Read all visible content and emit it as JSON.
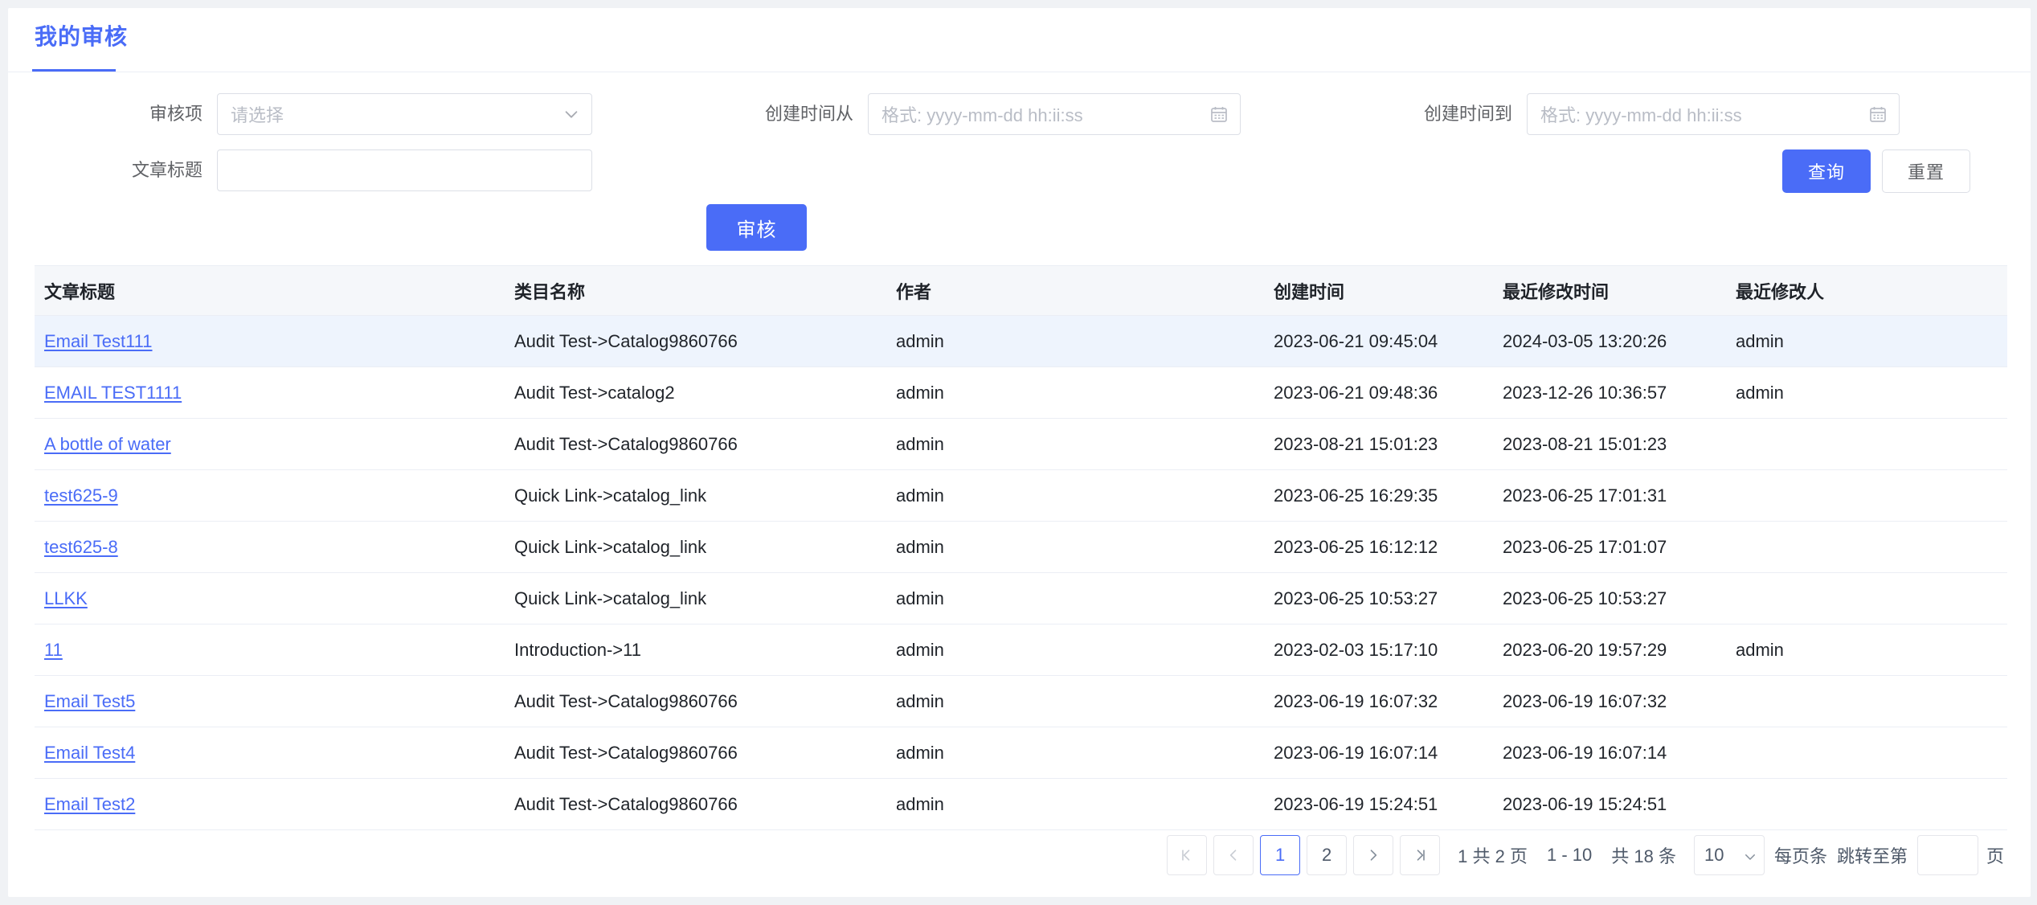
{
  "header": {
    "tab_label": "我的审核"
  },
  "filters": {
    "audit_item": {
      "label": "审核项",
      "value": "请选择",
      "is_placeholder": true,
      "icon": "chevron-down-icon"
    },
    "article_title": {
      "label": "文章标题",
      "value": "",
      "placeholder": ""
    },
    "created_from": {
      "label": "创建时间从",
      "value": "",
      "placeholder": "格式: yyyy-mm-dd hh:ii:ss",
      "icon": "calendar-icon"
    },
    "created_to": {
      "label": "创建时间到",
      "value": "",
      "placeholder": "格式: yyyy-mm-dd hh:ii:ss",
      "icon": "calendar-icon"
    },
    "query_button": "查询",
    "reset_button": "重置"
  },
  "actions": {
    "audit_button": "审核"
  },
  "table": {
    "columns": [
      "文章标题",
      "类目名称",
      "作者",
      "创建时间",
      "最近修改时间",
      "最近修改人"
    ],
    "rows": [
      {
        "title": "Email Test111",
        "catalog": "Audit Test->Catalog9860766",
        "author": "admin",
        "created": "2023-06-21 09:45:04",
        "modified": "2024-03-05 13:20:26",
        "modifier": "admin",
        "highlighted": true
      },
      {
        "title": "EMAIL TEST1111",
        "catalog": "Audit Test->catalog2",
        "author": "admin",
        "created": "2023-06-21 09:48:36",
        "modified": "2023-12-26 10:36:57",
        "modifier": "admin",
        "highlighted": false
      },
      {
        "title": "A bottle of water",
        "catalog": "Audit Test->Catalog9860766",
        "author": "admin",
        "created": "2023-08-21 15:01:23",
        "modified": "2023-08-21 15:01:23",
        "modifier": "",
        "highlighted": false
      },
      {
        "title": "test625-9",
        "catalog": "Quick Link->catalog_link",
        "author": "admin",
        "created": "2023-06-25 16:29:35",
        "modified": "2023-06-25 17:01:31",
        "modifier": "",
        "highlighted": false
      },
      {
        "title": "test625-8",
        "catalog": "Quick Link->catalog_link",
        "author": "admin",
        "created": "2023-06-25 16:12:12",
        "modified": "2023-06-25 17:01:07",
        "modifier": "",
        "highlighted": false
      },
      {
        "title": "LLKK",
        "catalog": "Quick Link->catalog_link",
        "author": "admin",
        "created": "2023-06-25 10:53:27",
        "modified": "2023-06-25 10:53:27",
        "modifier": "",
        "highlighted": false
      },
      {
        "title": "11",
        "catalog": "Introduction->11",
        "author": "admin",
        "created": "2023-02-03 15:17:10",
        "modified": "2023-06-20 19:57:29",
        "modifier": "admin",
        "highlighted": false
      },
      {
        "title": "Email Test5",
        "catalog": "Audit Test->Catalog9860766",
        "author": "admin",
        "created": "2023-06-19 16:07:32",
        "modified": "2023-06-19 16:07:32",
        "modifier": "",
        "highlighted": false
      },
      {
        "title": "Email Test4",
        "catalog": "Audit Test->Catalog9860766",
        "author": "admin",
        "created": "2023-06-19 16:07:14",
        "modified": "2023-06-19 16:07:14",
        "modifier": "",
        "highlighted": false
      },
      {
        "title": "Email Test2",
        "catalog": "Audit Test->Catalog9860766",
        "author": "admin",
        "created": "2023-06-19 15:24:51",
        "modified": "2023-06-19 15:24:51",
        "modifier": "",
        "highlighted": false
      }
    ]
  },
  "pagination": {
    "first_icon": "double-chevron-left-icon",
    "prev_icon": "chevron-left-icon",
    "pages": [
      "1",
      "2"
    ],
    "current_page": "1",
    "next_icon": "chevron-right-icon",
    "last_icon": "double-chevron-right-icon",
    "page_info": "1 共 2 页",
    "range_info": "1 - 10",
    "total_info": "共 18 条",
    "page_size": "10",
    "page_size_label": "每页条",
    "jump_label": "跳转至第",
    "jump_value": "",
    "jump_unit": "页"
  },
  "colors": {
    "accent": "#4a6cf7",
    "row_highlight": "#eef4fd",
    "header_bg": "#f5f7fa",
    "border": "#ebeef5",
    "text": "#1f2329",
    "muted": "#606266",
    "placeholder": "#b9bdc6"
  }
}
